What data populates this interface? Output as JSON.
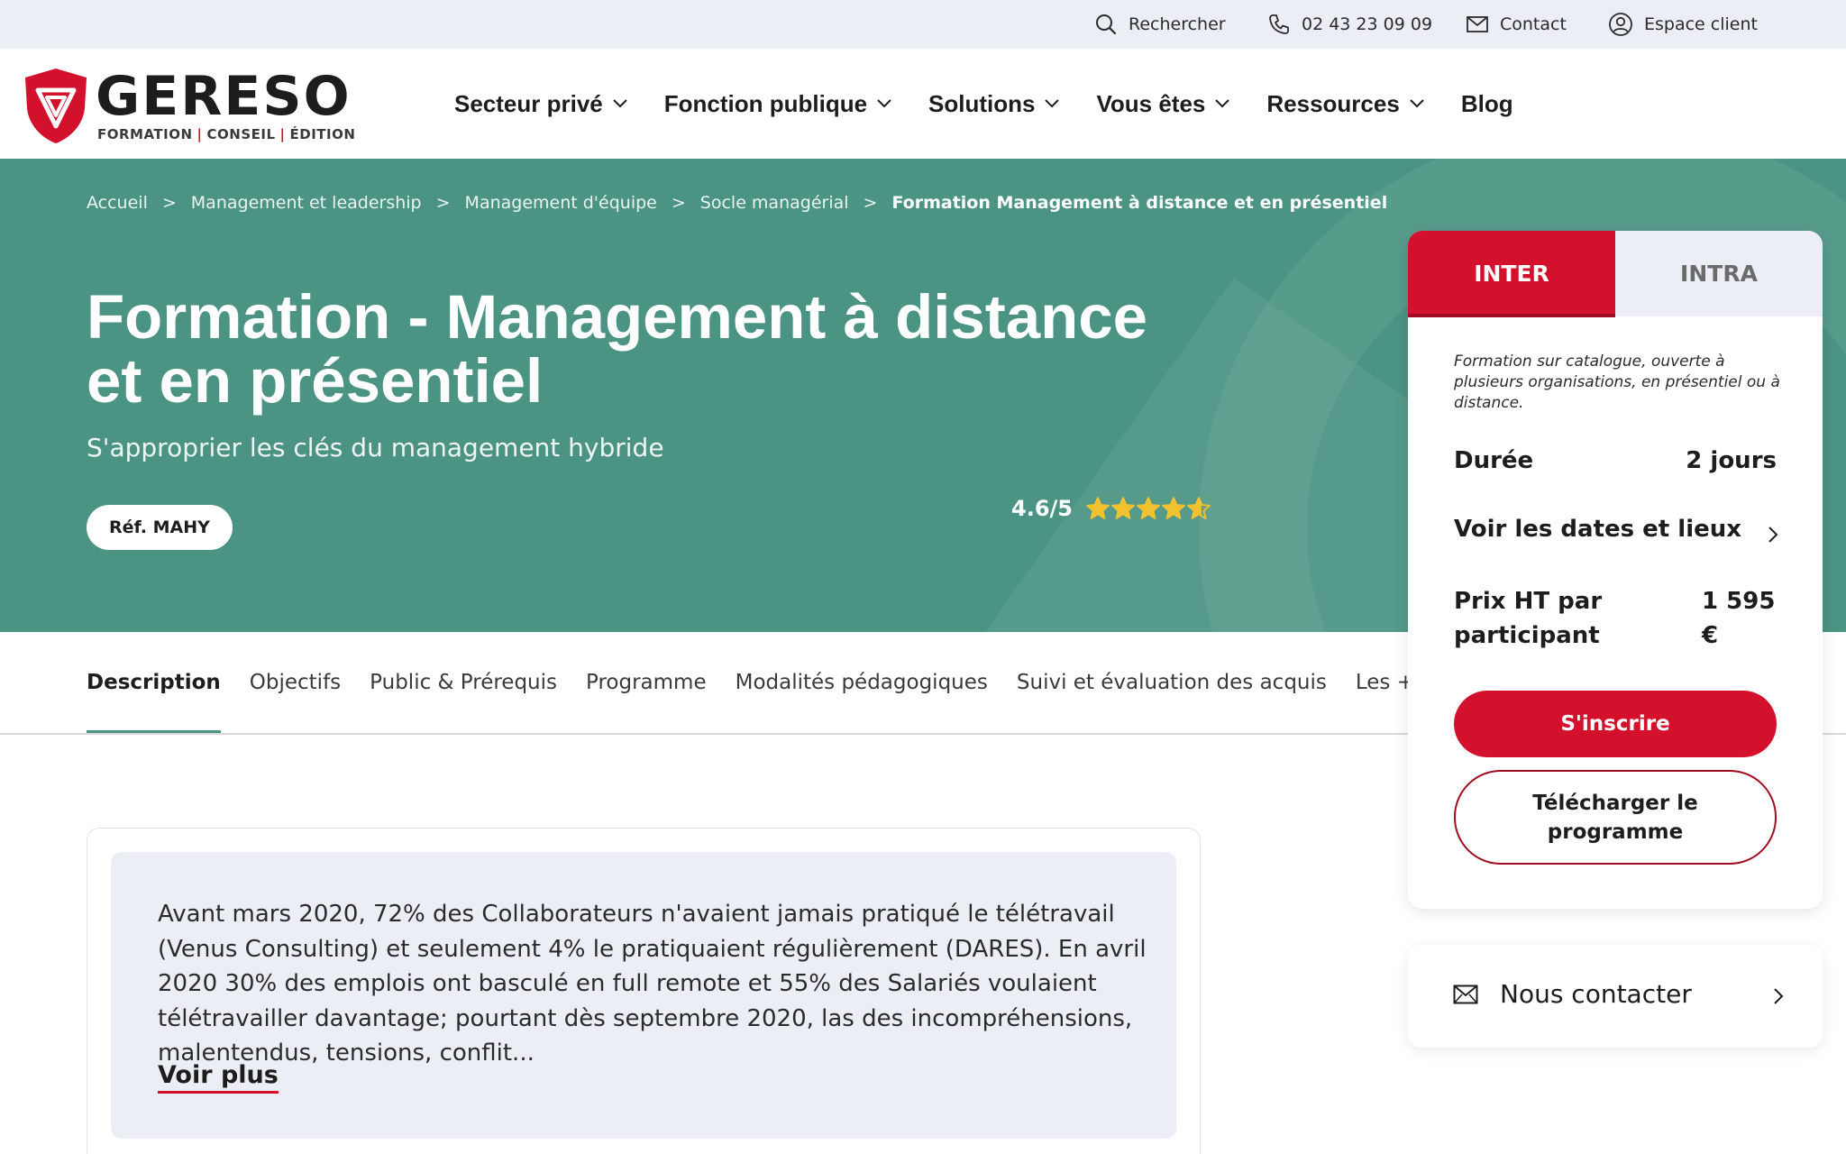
{
  "topbar": {
    "search_label": "Rechercher",
    "phone_label": "02 43 23 09 09",
    "contact_label": "Contact",
    "client_label": "Espace client"
  },
  "logo": {
    "wordmark": "GERESO",
    "tagline_1": "FORMATION",
    "tagline_2": "CONSEIL",
    "tagline_3": "ÉDITION"
  },
  "nav": {
    "items": [
      {
        "label": "Secteur privé",
        "dropdown": true
      },
      {
        "label": "Fonction publique",
        "dropdown": true
      },
      {
        "label": "Solutions",
        "dropdown": true
      },
      {
        "label": "Vous êtes",
        "dropdown": true
      },
      {
        "label": "Ressources",
        "dropdown": true
      },
      {
        "label": "Blog",
        "dropdown": false
      }
    ]
  },
  "breadcrumb": {
    "items": [
      "Accueil",
      "Management et leadership",
      "Management d'équipe",
      "Socle managérial"
    ],
    "current": "Formation Management à distance et en présentiel",
    "separator": ">"
  },
  "hero": {
    "title_line1": "Formation - Management à distance",
    "title_line2": "et en présentiel",
    "subtitle": "S'approprier les clés du management hybride",
    "reference": "Réf. MAHY",
    "rating_text": "4.6/5",
    "rating_value": 4.6,
    "rating_max": 5
  },
  "tabs": {
    "items": [
      "Description",
      "Objectifs",
      "Public & Prérequis",
      "Programme",
      "Modalités pédagogiques",
      "Suivi et évaluation des acquis",
      "Les + de cette formation"
    ],
    "active_index": 0
  },
  "description": {
    "text": "Avant mars 2020, 72% des Collaborateurs n'avaient jamais pratiqué le télétravail (Venus Consulting) et seulement 4% le pratiquaient régulièrement (DARES). En avril 2020 30% des emplois ont basculé en full remote et 55% des Salariés voulaient télétravailler davantage; pourtant dès septembre 2020, las des incompréhensions, malentendus, tensions, conflit...",
    "more_label": "Voir plus"
  },
  "panel": {
    "tab_inter": "INTER",
    "tab_intra": "INTRA",
    "active_tab": "INTER",
    "info": "Formation sur catalogue, ouverte à plusieurs organisations, en présentiel ou à distance.",
    "duration_label": "Durée",
    "duration_value": "2 jours",
    "dates_label": "Voir les dates et lieux",
    "price_label_1": "Prix HT par",
    "price_label_2": "participant",
    "price_value_1": "1 595",
    "price_value_2": "€",
    "register_label": "S'inscrire",
    "download_label": "Télécharger le programme"
  },
  "contact_card": {
    "label": "Nous contacter"
  },
  "colors": {
    "brand_red": "#d4112c",
    "hero_green": "#4b9483",
    "topbar_bg": "#eceef6",
    "star_gold": "#f2c12e"
  },
  "icons": {
    "search": "search-icon",
    "phone": "phone-icon",
    "mail": "mail-icon",
    "user": "user-circle-icon",
    "chevron_down": "chevron-down-icon",
    "chevron_right": "chevron-right-icon",
    "star": "star-icon"
  }
}
